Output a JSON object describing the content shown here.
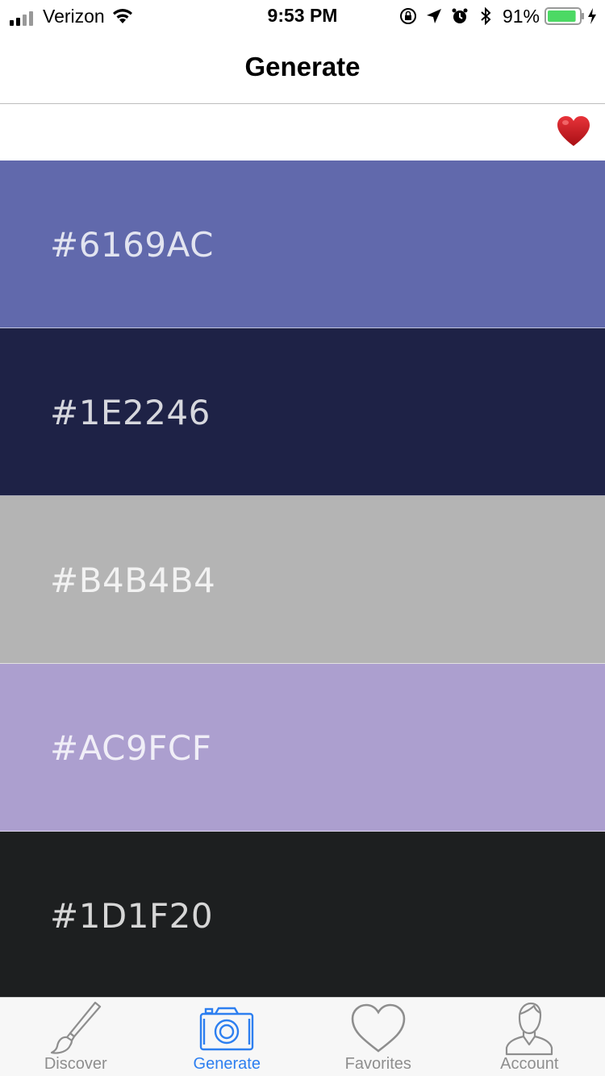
{
  "status_bar": {
    "carrier": "Verizon",
    "time": "9:53 PM",
    "battery_percent": "91%",
    "battery_level": 0.91,
    "icons": [
      "signal-icon",
      "wifi-icon",
      "orientation-lock-icon",
      "location-icon",
      "alarm-icon",
      "bluetooth-icon",
      "battery-icon",
      "charging-icon"
    ]
  },
  "nav": {
    "title": "Generate"
  },
  "favorite": {
    "icon": "heart-icon",
    "color": "#c8161d"
  },
  "palette": {
    "swatches": [
      {
        "hex": "#6169AC",
        "color": "#6169AC"
      },
      {
        "hex": "#1E2246",
        "color": "#1E2246"
      },
      {
        "hex": "#B4B4B4",
        "color": "#B4B4B4"
      },
      {
        "hex": "#AC9FCF",
        "color": "#AC9FCF"
      },
      {
        "hex": "#1D1F20",
        "color": "#1D1F20"
      }
    ]
  },
  "tab_bar": {
    "active_color": "#2d7ff0",
    "inactive_color": "#8e8e8e",
    "tabs": [
      {
        "label": "Discover",
        "icon": "paintbrush-icon",
        "active": false
      },
      {
        "label": "Generate",
        "icon": "camera-icon",
        "active": true
      },
      {
        "label": "Favorites",
        "icon": "heart-outline-icon",
        "active": false
      },
      {
        "label": "Account",
        "icon": "user-icon",
        "active": false
      }
    ]
  }
}
